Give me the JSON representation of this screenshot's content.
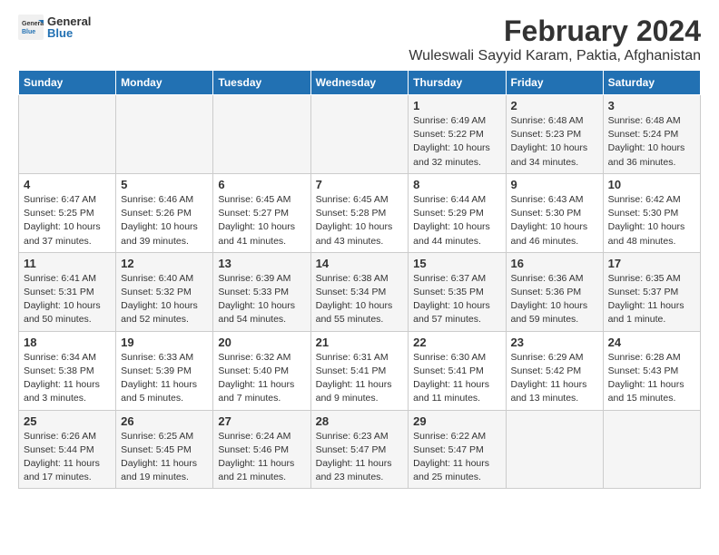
{
  "logo": {
    "general": "General",
    "blue": "Blue"
  },
  "title": "February 2024",
  "subtitle": "Wuleswali Sayyid Karam, Paktia, Afghanistan",
  "days_of_week": [
    "Sunday",
    "Monday",
    "Tuesday",
    "Wednesday",
    "Thursday",
    "Friday",
    "Saturday"
  ],
  "weeks": [
    [
      {
        "day": "",
        "info": ""
      },
      {
        "day": "",
        "info": ""
      },
      {
        "day": "",
        "info": ""
      },
      {
        "day": "",
        "info": ""
      },
      {
        "day": "1",
        "info": "Sunrise: 6:49 AM\nSunset: 5:22 PM\nDaylight: 10 hours and 32 minutes."
      },
      {
        "day": "2",
        "info": "Sunrise: 6:48 AM\nSunset: 5:23 PM\nDaylight: 10 hours and 34 minutes."
      },
      {
        "day": "3",
        "info": "Sunrise: 6:48 AM\nSunset: 5:24 PM\nDaylight: 10 hours and 36 minutes."
      }
    ],
    [
      {
        "day": "4",
        "info": "Sunrise: 6:47 AM\nSunset: 5:25 PM\nDaylight: 10 hours and 37 minutes."
      },
      {
        "day": "5",
        "info": "Sunrise: 6:46 AM\nSunset: 5:26 PM\nDaylight: 10 hours and 39 minutes."
      },
      {
        "day": "6",
        "info": "Sunrise: 6:45 AM\nSunset: 5:27 PM\nDaylight: 10 hours and 41 minutes."
      },
      {
        "day": "7",
        "info": "Sunrise: 6:45 AM\nSunset: 5:28 PM\nDaylight: 10 hours and 43 minutes."
      },
      {
        "day": "8",
        "info": "Sunrise: 6:44 AM\nSunset: 5:29 PM\nDaylight: 10 hours and 44 minutes."
      },
      {
        "day": "9",
        "info": "Sunrise: 6:43 AM\nSunset: 5:30 PM\nDaylight: 10 hours and 46 minutes."
      },
      {
        "day": "10",
        "info": "Sunrise: 6:42 AM\nSunset: 5:30 PM\nDaylight: 10 hours and 48 minutes."
      }
    ],
    [
      {
        "day": "11",
        "info": "Sunrise: 6:41 AM\nSunset: 5:31 PM\nDaylight: 10 hours and 50 minutes."
      },
      {
        "day": "12",
        "info": "Sunrise: 6:40 AM\nSunset: 5:32 PM\nDaylight: 10 hours and 52 minutes."
      },
      {
        "day": "13",
        "info": "Sunrise: 6:39 AM\nSunset: 5:33 PM\nDaylight: 10 hours and 54 minutes."
      },
      {
        "day": "14",
        "info": "Sunrise: 6:38 AM\nSunset: 5:34 PM\nDaylight: 10 hours and 55 minutes."
      },
      {
        "day": "15",
        "info": "Sunrise: 6:37 AM\nSunset: 5:35 PM\nDaylight: 10 hours and 57 minutes."
      },
      {
        "day": "16",
        "info": "Sunrise: 6:36 AM\nSunset: 5:36 PM\nDaylight: 10 hours and 59 minutes."
      },
      {
        "day": "17",
        "info": "Sunrise: 6:35 AM\nSunset: 5:37 PM\nDaylight: 11 hours and 1 minute."
      }
    ],
    [
      {
        "day": "18",
        "info": "Sunrise: 6:34 AM\nSunset: 5:38 PM\nDaylight: 11 hours and 3 minutes."
      },
      {
        "day": "19",
        "info": "Sunrise: 6:33 AM\nSunset: 5:39 PM\nDaylight: 11 hours and 5 minutes."
      },
      {
        "day": "20",
        "info": "Sunrise: 6:32 AM\nSunset: 5:40 PM\nDaylight: 11 hours and 7 minutes."
      },
      {
        "day": "21",
        "info": "Sunrise: 6:31 AM\nSunset: 5:41 PM\nDaylight: 11 hours and 9 minutes."
      },
      {
        "day": "22",
        "info": "Sunrise: 6:30 AM\nSunset: 5:41 PM\nDaylight: 11 hours and 11 minutes."
      },
      {
        "day": "23",
        "info": "Sunrise: 6:29 AM\nSunset: 5:42 PM\nDaylight: 11 hours and 13 minutes."
      },
      {
        "day": "24",
        "info": "Sunrise: 6:28 AM\nSunset: 5:43 PM\nDaylight: 11 hours and 15 minutes."
      }
    ],
    [
      {
        "day": "25",
        "info": "Sunrise: 6:26 AM\nSunset: 5:44 PM\nDaylight: 11 hours and 17 minutes."
      },
      {
        "day": "26",
        "info": "Sunrise: 6:25 AM\nSunset: 5:45 PM\nDaylight: 11 hours and 19 minutes."
      },
      {
        "day": "27",
        "info": "Sunrise: 6:24 AM\nSunset: 5:46 PM\nDaylight: 11 hours and 21 minutes."
      },
      {
        "day": "28",
        "info": "Sunrise: 6:23 AM\nSunset: 5:47 PM\nDaylight: 11 hours and 23 minutes."
      },
      {
        "day": "29",
        "info": "Sunrise: 6:22 AM\nSunset: 5:47 PM\nDaylight: 11 hours and 25 minutes."
      },
      {
        "day": "",
        "info": ""
      },
      {
        "day": "",
        "info": ""
      }
    ]
  ]
}
